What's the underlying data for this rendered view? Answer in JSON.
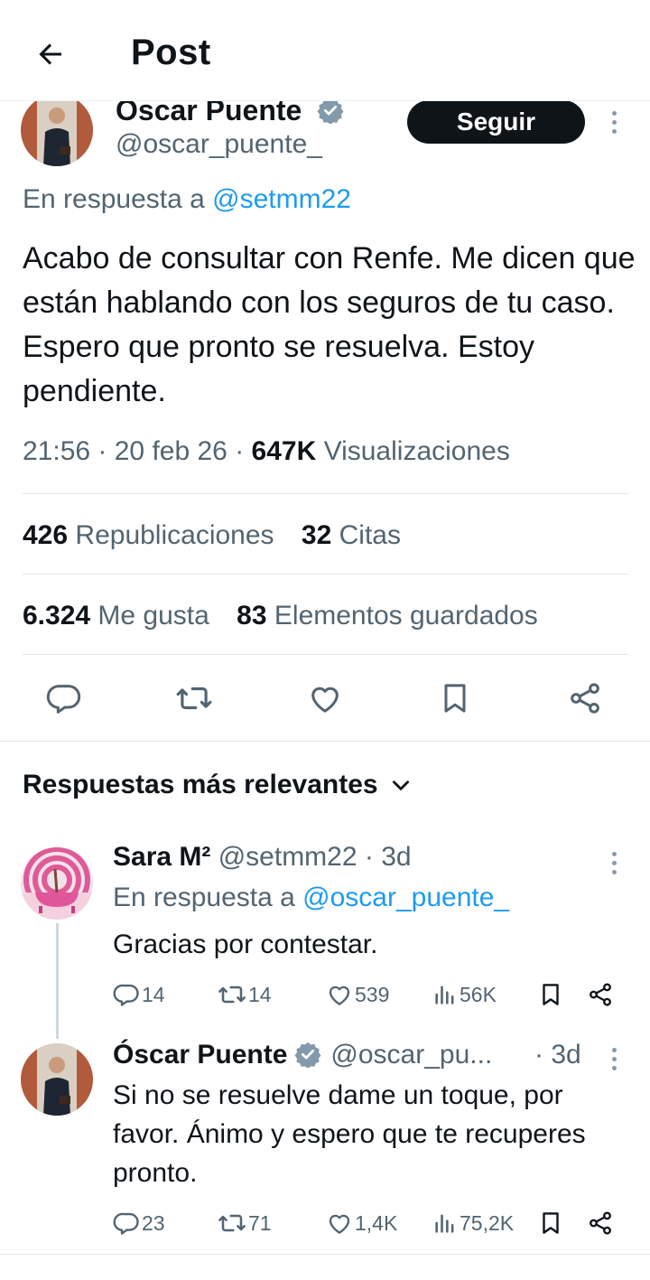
{
  "header": {
    "title": "Post",
    "back_icon": "arrow-left-icon"
  },
  "post": {
    "author_name": "Oscar Puente",
    "author_handle": "@oscar_puente_",
    "verified": true,
    "follow_label": "Seguir",
    "reply_prefix": "En respuesta a",
    "reply_handle": "@setmm22",
    "text": "Acabo de consultar con Renfe. Me dicen que están hablando con los seguros de tu caso. Espero que pronto se resuelva. Estoy pendiente.",
    "time": "21:56",
    "date": "20 feb 26",
    "views_count": "647K",
    "views_label": "Visualizaciones",
    "reposts_count": "426",
    "reposts_label": "Republicaciones",
    "quotes_count": "32",
    "quotes_label": "Citas",
    "likes_count": "6.324",
    "likes_label": "Me gusta",
    "bookmarks_count": "83",
    "bookmarks_label": "Elementos guardados"
  },
  "replies_section": {
    "title": "Respuestas más relevantes"
  },
  "replies": [
    {
      "name": "Sara M²",
      "handle": "@setmm22",
      "time": "3d",
      "reply_prefix": "En respuesta a",
      "reply_handle": "@oscar_puente_",
      "text": "Gracias por contestar.",
      "comments": "14",
      "reposts": "14",
      "likes": "539",
      "views": "56K"
    },
    {
      "name": "Óscar Puente",
      "handle": "@oscar_pu...",
      "time": "3d",
      "verified": true,
      "text": "Si no se resuelve dame un toque, por favor. Ánimo y espero que te recuperes pronto.",
      "comments": "23",
      "reposts": "71",
      "likes": "1,4K",
      "views": "75,2K"
    }
  ],
  "colors": {
    "text": "#0f1419",
    "muted": "#536471",
    "link": "#1d9bf0",
    "follow_button": "#0f1419",
    "verified_badge": "#829aab",
    "divider": "#e1e8ed"
  }
}
